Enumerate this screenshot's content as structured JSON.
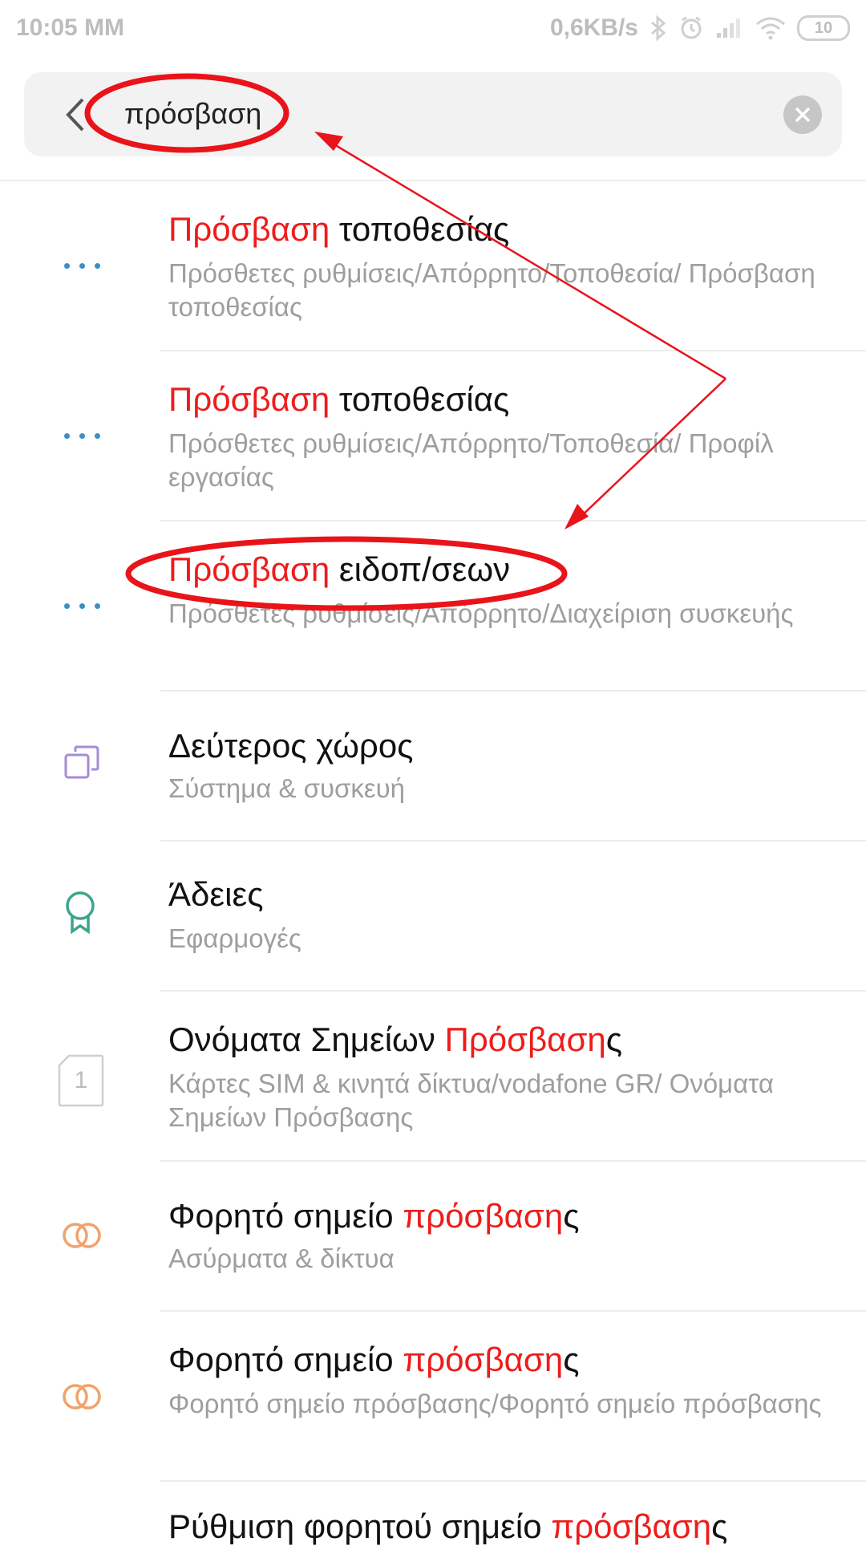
{
  "status_bar": {
    "time": "10:05 ΜΜ",
    "net_speed": "0,6KB/s",
    "battery": "10"
  },
  "search": {
    "value": "πρόσβαση",
    "placeholder": ""
  },
  "results": [
    {
      "title_hl": "Πρόσβαση",
      "title_rest": " τοποθεσίας",
      "subtitle": "Πρόσθετες ρυθμίσεις/Απόρρητο/Τοποθεσία/ Πρόσβαση τοποθεσίας",
      "icon": "more-dots-icon"
    },
    {
      "title_hl": "Πρόσβαση",
      "title_rest": " τοποθεσίας",
      "subtitle": "Πρόσθετες ρυθμίσεις/Απόρρητο/Τοποθεσία/ Προφίλ εργασίας",
      "icon": "more-dots-icon"
    },
    {
      "title_hl": "Πρόσβαση",
      "title_rest": " ειδοπ/σεων",
      "subtitle": "Πρόσθετες ρυθμίσεις/Απόρρητο/Διαχείριση συσκευής",
      "icon": "more-dots-icon"
    },
    {
      "title_pre": "Δεύτερος χώρος",
      "subtitle": "Σύστημα & συσκευή",
      "icon": "second-space-icon"
    },
    {
      "title_pre": "Άδειες",
      "subtitle": "Εφαρμογές",
      "icon": "permissions-badge-icon"
    },
    {
      "title_pre": "Ονόματα Σημείων ",
      "title_hl": "Πρόσβαση",
      "title_rest": "ς",
      "subtitle": "Κάρτες SIM & κινητά δίκτυα/vodafone GR/ Ονόματα Σημείων Πρόσβασης",
      "icon": "sim-card-icon",
      "sim_number": "1"
    },
    {
      "title_pre": "Φορητό σημείο ",
      "title_hl": "πρόσβαση",
      "title_rest": "ς",
      "subtitle": "Ασύρματα & δίκτυα",
      "icon": "hotspot-rings-icon"
    },
    {
      "title_pre": "Φορητό σημείο ",
      "title_hl": "πρόσβαση",
      "title_rest": "ς",
      "subtitle": "Φορητό σημείο πρόσβασης/Φορητό σημείο πρόσβασης",
      "icon": "hotspot-rings-icon"
    },
    {
      "title_pre": "Ρύθμιση φορητού σημείο ",
      "title_hl": "πρόσβαση",
      "title_rest": "ς",
      "subtitle": "",
      "icon": ""
    }
  ],
  "colors": {
    "highlight": "#ee1c1c",
    "annotation": "#e8141a",
    "dots": "#3b8fc5",
    "second_space": "#a78bd6",
    "permissions": "#3aa58c",
    "hotspot": "#f0a36b"
  }
}
